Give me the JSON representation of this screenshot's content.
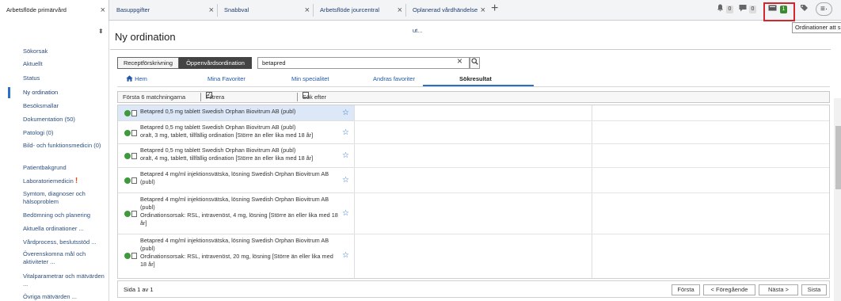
{
  "tabs": [
    {
      "label": "Arbetsflöde primärvård",
      "close": "×"
    },
    {
      "label": "Basuppgifter",
      "close": "×"
    },
    {
      "label": "Snabbval",
      "close": "×"
    },
    {
      "label": "Arbetsflöde jourcentral",
      "close": "×"
    },
    {
      "label": "Oplanerad vårdhändelse ut...",
      "close": "×"
    }
  ],
  "tab_add": "+",
  "status_icons": {
    "bell_count": "0",
    "message_count": "0",
    "orders_count": "1",
    "menu_glyph": "≡·"
  },
  "tooltip": "Ordinationer att signera",
  "sidebar": {
    "pin_glyph": "⬍",
    "items": [
      {
        "label": "Sökorsak"
      },
      {
        "label": "Aktuellt"
      },
      {
        "label": "Status"
      },
      {
        "label": "Ny ordination"
      },
      {
        "label": "Besöksmallar"
      },
      {
        "label": "Dokumentation (50)"
      },
      {
        "label": "Patologi (0)"
      },
      {
        "label": "Bild- och funktionsmedicin (0)"
      },
      {
        "label": "Patientbakgrund"
      },
      {
        "label": "Laboratoriemedicin",
        "flag": "!"
      },
      {
        "label": "Symtom, diagnoser och hälsoproblem"
      },
      {
        "label": "Bedömning och planering"
      },
      {
        "label": "Aktuella ordinationer ..."
      },
      {
        "label": "Vårdprocess, beslutsstöd ..."
      },
      {
        "label": "Överenskomna mål och aktiviteter ..."
      },
      {
        "label": "Vitalparametrar och mätvärden ..."
      },
      {
        "label": "Övriga mätvärden ..."
      }
    ]
  },
  "main": {
    "title": "Ny ordination",
    "mode_buttons": [
      "Receptförskrivning",
      "Öppenvårdsordination"
    ],
    "search_value": "betapred",
    "search_clear": "×",
    "search_icon": "magnifier-icon",
    "nav_tabs": [
      "Hem",
      "Mina Favoriter",
      "Min specialitet",
      "Andras favoriter",
      "Sökresultat"
    ],
    "filter": {
      "matches": "Första 6 matchningarna",
      "filter_label": "Filtrera ordinationsmallar",
      "search_more_label": "Sök efter ytterligare objekt",
      "checked_mark": "✓"
    },
    "results": [
      {
        "line1": "Betapred 0,5 mg tablett Swedish Orphan Biovitrum AB (publ)",
        "line2": ""
      },
      {
        "line1": "Betapred 0,5 mg tablett Swedish Orphan Biovitrum AB (publ)",
        "line2": "oralt, 3 mg, tablett, tillfällig ordination [Större än eller lika med 18 år]"
      },
      {
        "line1": "Betapred 0,5 mg tablett Swedish Orphan Biovitrum AB (publ)",
        "line2": "oralt, 4 mg, tablett, tillfällig ordination [Större än eller lika med 18 år]"
      },
      {
        "line1": "Betapred 4 mg/ml injektionsvätska, lösning Swedish Orphan Biovitrum AB (publ)",
        "line2": ""
      },
      {
        "line1": "Betapred 4 mg/ml injektionsvätska, lösning Swedish Orphan Biovitrum AB (publ)",
        "line2": "Ordinationsorsak: RSL, intravenöst, 4 mg, lösning [Större än eller lika med 18 år]"
      },
      {
        "line1": "Betapred 4 mg/ml injektionsvätska, lösning Swedish Orphan Biovitrum AB (publ)",
        "line2": "Ordinationsorsak: RSL, intravenöst, 20 mg, lösning [Större än eller lika med 18 år]"
      }
    ],
    "row_star": "☆",
    "pager": {
      "info": "Sida 1 av 1",
      "first": "Första",
      "prev": "< Föregående",
      "next": "Nästa >",
      "last": "Sista"
    }
  }
}
